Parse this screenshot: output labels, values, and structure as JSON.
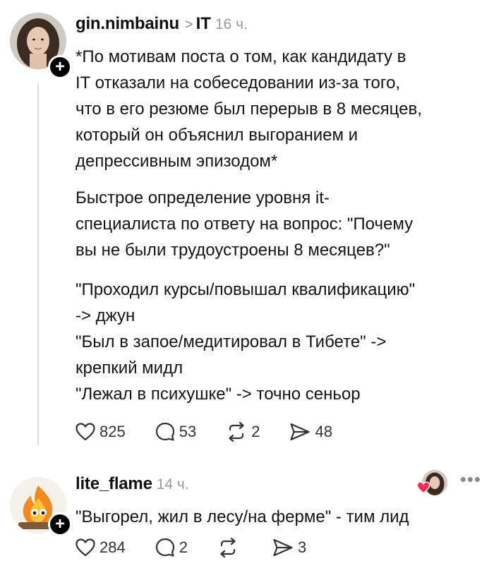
{
  "post1": {
    "username": "gin.nimbainu",
    "topic": "IT",
    "time": "16 ч.",
    "paragraphs": [
      [
        "*По мотивам поста о том, как кандидату в",
        "IT отказали на собеседовании из-за того,",
        "что в его резюме был перерыв в 8 месяцев,",
        "который он объяснил выгоранием и",
        "депрессивным эпизодом*"
      ],
      [
        "Быстрое определение уровня it-",
        "специалиста по ответу на вопрос: \"Почему",
        "вы не были трудоустроены 8 месяцев?\""
      ],
      [
        "\"Проходил курсы/повышал квалификацию\"",
        "-> джун",
        "\"Был в запое/медитировал в Тибете\" ->",
        "крепкий мидл",
        "\"Лежал в психушке\" -> точно сеньор"
      ]
    ],
    "likes": "825",
    "comments": "53",
    "reposts": "2",
    "shares": "48"
  },
  "post2": {
    "username": "lite_flame",
    "time": "14 ч.",
    "text": "\"Выгорел, жил в лесу/на ферме\" - тим лид",
    "likes": "284",
    "comments": "2",
    "reposts": "",
    "shares": "3"
  },
  "ui": {
    "follow_symbol": "+",
    "chevron": ">",
    "more": "•••"
  },
  "icons": [
    "heart-icon",
    "comment-icon",
    "repost-icon",
    "share-icon",
    "follow-plus-icon",
    "more-icon"
  ]
}
